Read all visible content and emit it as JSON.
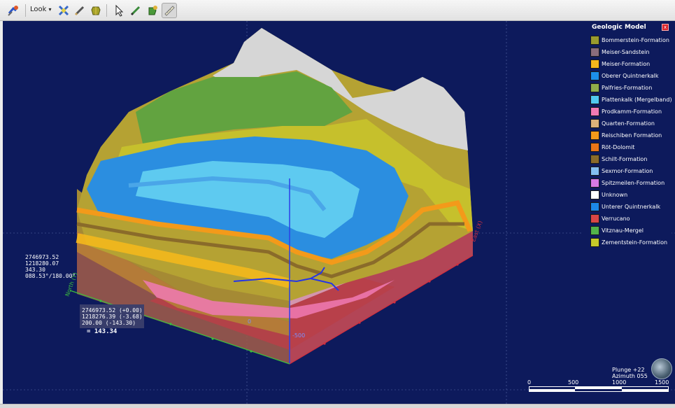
{
  "toolbar": {
    "look_label": "Look",
    "look_caret": "▾",
    "icons": [
      "geologic-model-icon",
      "look-dropdown",
      "select-tool-icon",
      "measure-pencil-icon",
      "cube-rotate-icon",
      "pointer-icon",
      "edit-pencil-icon",
      "cube-pick-icon",
      "ruler-icon"
    ]
  },
  "legend": {
    "title": "Geologic Model",
    "close": "x",
    "items": [
      {
        "label": "Bommerstein-Formation",
        "color": "#9a9b2e"
      },
      {
        "label": "Meiser-Sandstein",
        "color": "#8a6d7c"
      },
      {
        "label": "Meiser-Formation",
        "color": "#f3b81c"
      },
      {
        "label": "Oberer Quintnerkalk",
        "color": "#1c8fe8"
      },
      {
        "label": "Palfries-Formation",
        "color": "#8fae4a"
      },
      {
        "label": "Plattenkalk (Mergelband)",
        "color": "#50c8ee"
      },
      {
        "label": "Prodkamm-Formation",
        "color": "#f07ab4"
      },
      {
        "label": "Quarten-Formation",
        "color": "#dcb27a"
      },
      {
        "label": "Reischiben Formation",
        "color": "#f39a1a"
      },
      {
        "label": "Röt-Dolomit",
        "color": "#ea7518"
      },
      {
        "label": "Schilt-Formation",
        "color": "#8a6b2a"
      },
      {
        "label": "Sexmor-Formation",
        "color": "#84bff0"
      },
      {
        "label": "Spitzmeilen-Formation",
        "color": "#d77ae3"
      },
      {
        "label": "Unknown",
        "color": "#ffffff"
      },
      {
        "label": "Unterer Quintnerkalk",
        "color": "#1c88e8"
      },
      {
        "label": "Verrucano",
        "color": "#d84646"
      },
      {
        "label": "Vitznau-Mergel",
        "color": "#52b24a"
      },
      {
        "label": "Zementstein-Formation",
        "color": "#c5c92a"
      }
    ]
  },
  "cursor_readout": {
    "lines": [
      "2746973.52",
      "1218280.07",
      "343.30",
      "088.53°/180.00°"
    ]
  },
  "pick_readout": {
    "lines": [
      "2746973.52 (+0.00)",
      "1218276.39 (-3.68)",
      "200.00 (-143.30)"
    ],
    "distance": "= 143.34"
  },
  "axes": {
    "north": "North (Y)",
    "east": "East (X)",
    "z_label": "-500",
    "zero": "0"
  },
  "orientation": {
    "plunge": "Plunge +22",
    "azimuth": "Azimuth 055"
  },
  "scale": {
    "ticks": [
      "0",
      "500",
      "1000",
      "1500"
    ]
  }
}
